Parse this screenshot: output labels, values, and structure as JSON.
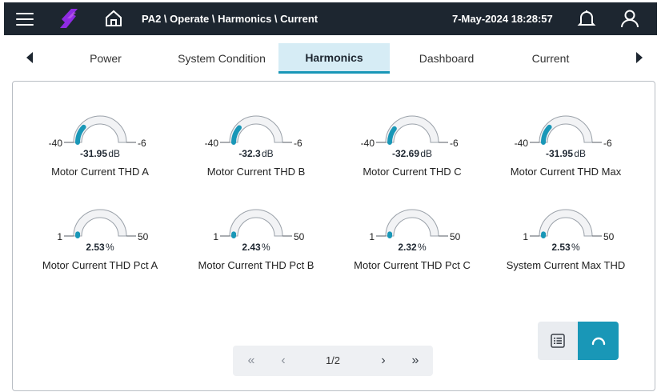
{
  "header": {
    "breadcrumb": "PA2 \\ Operate \\ Harmonics \\ Current",
    "datetime": "7-May-2024 18:28:57"
  },
  "tabs": [
    {
      "label": "Power",
      "active": false
    },
    {
      "label": "System Condition",
      "active": false
    },
    {
      "label": "Harmonics",
      "active": true
    },
    {
      "label": "Dashboard",
      "active": false
    },
    {
      "label": "Current",
      "active": false
    }
  ],
  "gauges": [
    {
      "min": "-40",
      "max": "-6",
      "value": "-31.95",
      "unit": "dB",
      "label": "Motor Current THD A",
      "fraction": 0.24
    },
    {
      "min": "-40",
      "max": "-6",
      "value": "-32.3",
      "unit": "dB",
      "label": "Motor Current THD B",
      "fraction": 0.23
    },
    {
      "min": "-40",
      "max": "-6",
      "value": "-32.69",
      "unit": "dB",
      "label": "Motor Current THD C",
      "fraction": 0.21
    },
    {
      "min": "-40",
      "max": "-6",
      "value": "-31.95",
      "unit": "dB",
      "label": "Motor Current THD Max",
      "fraction": 0.24
    },
    {
      "min": "1",
      "max": "50",
      "value": "2.53",
      "unit": "%",
      "label": "Motor Current THD Pct A",
      "fraction": 0.03
    },
    {
      "min": "1",
      "max": "50",
      "value": "2.43",
      "unit": "%",
      "label": "Motor Current THD Pct B",
      "fraction": 0.03
    },
    {
      "min": "1",
      "max": "50",
      "value": "2.32",
      "unit": "%",
      "label": "Motor Current THD Pct C",
      "fraction": 0.03
    },
    {
      "min": "1",
      "max": "50",
      "value": "2.53",
      "unit": "%",
      "label": "System Current Max THD",
      "fraction": 0.03
    }
  ],
  "pager": {
    "first": "«",
    "prev": "‹",
    "page": "1/2",
    "next": "›",
    "last": "»"
  },
  "colors": {
    "header_bg": "#1d2630",
    "accent": "#1997b7",
    "logo": "#8e2be2",
    "tab_active_bg": "#d6ecf5"
  },
  "icons": {
    "menu": "hamburger-icon",
    "logo": "lightning-logo",
    "home": "home-icon",
    "notifications": "bell-icon",
    "user": "user-icon",
    "list_view": "list-view-icon",
    "gauge_view": "gauge-view-icon"
  }
}
